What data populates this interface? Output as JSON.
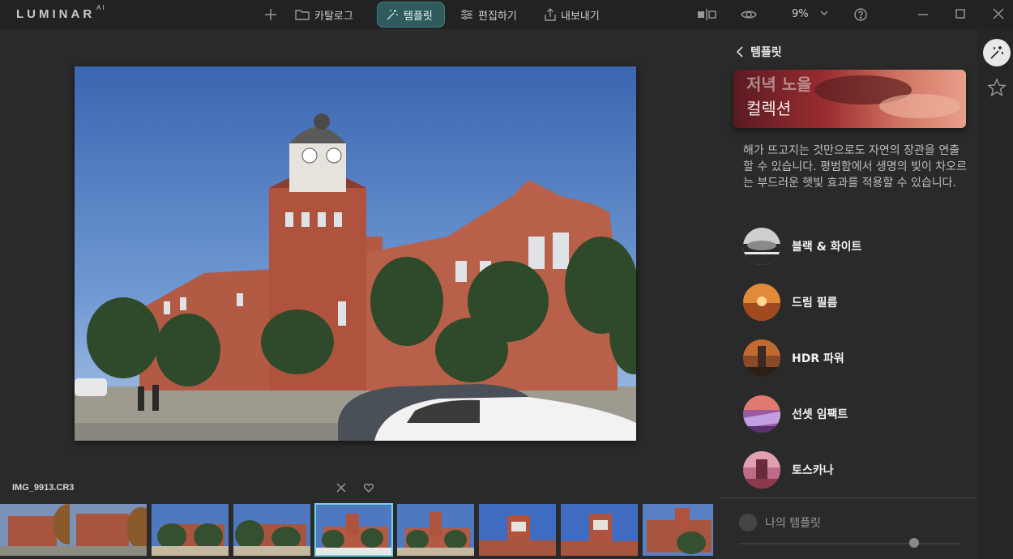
{
  "app": {
    "logo": "LUMINAR",
    "logo_suffix": "AI"
  },
  "toolbar": {
    "add_icon": "plus-icon",
    "catalog_label": "카탈로그",
    "templates_label": "템플릿",
    "edit_label": "편집하기",
    "export_label": "내보내기",
    "zoom": "9%"
  },
  "filmstrip": {
    "filename": "IMG_9913.CR3",
    "selected_index": 4,
    "thumb_count": 9
  },
  "panel": {
    "title": "템플릿",
    "banner_line1": "저녁 노을",
    "banner_line2": "컬렉션",
    "description": "해가 뜨고지는 것만으로도 자연의 장관을 연출할 수 있습니다. 평범함에서 생명의 빛이 차오르는 부드러운 햇빛 효과를 적용할 수 있습니다.",
    "templates": [
      {
        "label": "블랙 & 화이트"
      },
      {
        "label": "드림 필름"
      },
      {
        "label": "HDR 파워"
      },
      {
        "label": "선셋 임팩트"
      },
      {
        "label": "토스카나"
      }
    ],
    "my_templates": "나의 템플릿",
    "slider_value": 0.85
  },
  "colors": {
    "accent": "#3e7d7f",
    "selection": "#6fd6e4"
  }
}
